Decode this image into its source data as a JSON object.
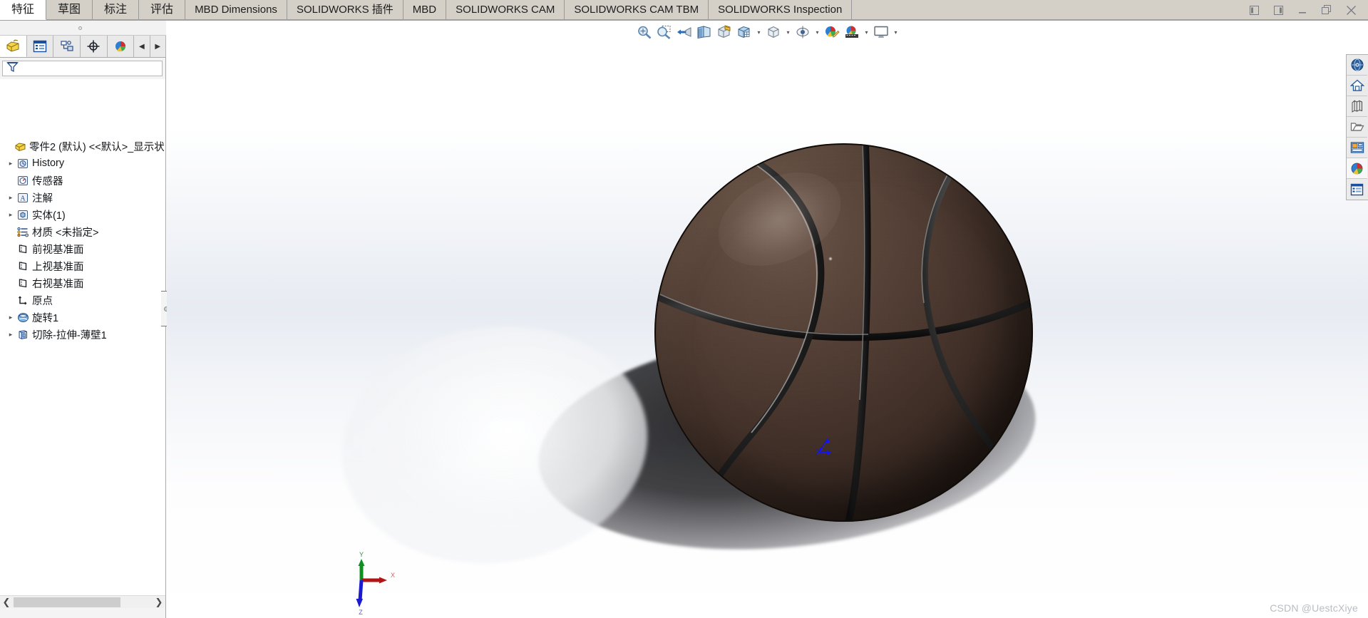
{
  "window": {
    "controls": [
      {
        "name": "restore-left-icon",
        "glyph": "◧"
      },
      {
        "name": "restore-right-icon",
        "glyph": "◨"
      },
      {
        "name": "minimize-icon",
        "glyph": "—"
      },
      {
        "name": "restore-icon",
        "glyph": "❐"
      },
      {
        "name": "close-icon",
        "glyph": "✕"
      }
    ]
  },
  "tabs": [
    {
      "label": "特征",
      "active": true,
      "cjk": true
    },
    {
      "label": "草图",
      "active": false,
      "cjk": true
    },
    {
      "label": "标注",
      "active": false,
      "cjk": true
    },
    {
      "label": "评估",
      "active": false,
      "cjk": true
    },
    {
      "label": "MBD Dimensions",
      "active": false,
      "cjk": false
    },
    {
      "label": "SOLIDWORKS 插件",
      "active": false,
      "cjk": false
    },
    {
      "label": "MBD",
      "active": false,
      "cjk": false
    },
    {
      "label": "SOLIDWORKS CAM",
      "active": false,
      "cjk": false
    },
    {
      "label": "SOLIDWORKS CAM TBM",
      "active": false,
      "cjk": false
    },
    {
      "label": "SOLIDWORKS Inspection",
      "active": false,
      "cjk": false
    }
  ],
  "left_panel": {
    "tabs": [
      {
        "name": "feature-manager-tab",
        "icon": "feature-tree-icon",
        "active": true
      },
      {
        "name": "property-manager-tab",
        "icon": "property-list-icon",
        "active": false
      },
      {
        "name": "configuration-manager-tab",
        "icon": "configuration-icon",
        "active": false
      },
      {
        "name": "dimxpert-manager-tab",
        "icon": "dimxpert-target-icon",
        "active": false
      },
      {
        "name": "display-manager-tab",
        "icon": "appearance-sphere-icon",
        "active": false
      }
    ],
    "nav_prev": "◀",
    "nav_next": "▶",
    "filter": {
      "placeholder": "",
      "value": "",
      "icon": "filter-funnel-icon"
    },
    "tree": [
      {
        "label": "零件2 (默认) <<默认>_显示状",
        "icon": "part-icon",
        "twisty": "",
        "indent": 0,
        "root": true
      },
      {
        "label": "History",
        "icon": "history-icon",
        "twisty": "▸",
        "indent": 1
      },
      {
        "label": "传感器",
        "icon": "sensor-icon",
        "twisty": "",
        "indent": 1
      },
      {
        "label": "注解",
        "icon": "annotations-icon",
        "twisty": "▸",
        "indent": 1
      },
      {
        "label": "实体(1)",
        "icon": "solid-bodies-icon",
        "twisty": "▸",
        "indent": 1
      },
      {
        "label": "材质 <未指定>",
        "icon": "material-icon",
        "twisty": "",
        "indent": 1
      },
      {
        "label": "前视基准面",
        "icon": "plane-icon",
        "twisty": "",
        "indent": 1
      },
      {
        "label": "上视基准面",
        "icon": "plane-icon",
        "twisty": "",
        "indent": 1
      },
      {
        "label": "右视基准面",
        "icon": "plane-icon",
        "twisty": "",
        "indent": 1
      },
      {
        "label": "原点",
        "icon": "origin-icon",
        "twisty": "",
        "indent": 1
      },
      {
        "label": "旋转1",
        "icon": "revolve-icon",
        "twisty": "▸",
        "indent": 1
      },
      {
        "label": "切除-拉伸-薄壁1",
        "icon": "cut-extrude-thin-icon",
        "twisty": "▸",
        "indent": 1
      }
    ],
    "hscroll": {
      "left_arrow": "❮",
      "right_arrow": "❯"
    }
  },
  "view_toolbar": [
    {
      "name": "zoom-to-fit-button",
      "icon": "zoom-fit-icon",
      "caret": false
    },
    {
      "name": "zoom-to-area-button",
      "icon": "zoom-area-icon",
      "caret": false
    },
    {
      "name": "previous-view-button",
      "icon": "previous-view-icon",
      "caret": false
    },
    {
      "name": "section-view-button",
      "icon": "section-view-icon",
      "caret": false
    },
    {
      "name": "view-orientation-button",
      "icon": "view-orientation-icon",
      "caret": false
    },
    {
      "name": "display-style-button",
      "icon": "display-style-icon",
      "caret": true
    },
    {
      "name": "hide-show-items-button",
      "icon": "hide-show-cube-icon",
      "caret": true
    },
    {
      "name": "view-settings-button",
      "icon": "view-settings-eye-icon",
      "caret": true
    },
    {
      "name": "edit-appearance-button",
      "icon": "edit-appearance-icon",
      "caret": false
    },
    {
      "name": "apply-scene-button",
      "icon": "apply-scene-icon",
      "caret": true
    },
    {
      "name": "viewport-layout-button",
      "icon": "viewport-monitor-icon",
      "caret": true
    }
  ],
  "right_sidebar": [
    {
      "name": "resources-button",
      "icon": "solidworks-resources-globe-icon"
    },
    {
      "name": "design-library-button",
      "icon": "design-library-home-icon"
    },
    {
      "name": "file-explorer-button",
      "icon": "file-explorer-books-icon"
    },
    {
      "name": "search-folder-button",
      "icon": "open-folder-icon"
    },
    {
      "name": "view-palette-button",
      "icon": "view-palette-icon"
    },
    {
      "name": "appearances-scenes-button",
      "icon": "appearances-sphere-icon"
    },
    {
      "name": "custom-properties-button",
      "icon": "custom-properties-icon"
    }
  ],
  "viewport": {
    "model_name": "basketball",
    "origin_marker_label": "",
    "axis_triad": {
      "x": "X",
      "y": "Y",
      "z": "Z"
    },
    "colors": {
      "ball_base": "#4c3930",
      "ball_highlight": "#6e584c",
      "ball_dark": "#241a15",
      "seam": "#15100d",
      "axis_x": "#b01414",
      "axis_y": "#0f8f20",
      "axis_z": "#1a1ad0",
      "origin_triad": "#1414f0",
      "background_top": "#ffffff",
      "background_mid": "#e7ebf2"
    }
  },
  "watermark": {
    "text": "CSDN @UestcXiye"
  }
}
